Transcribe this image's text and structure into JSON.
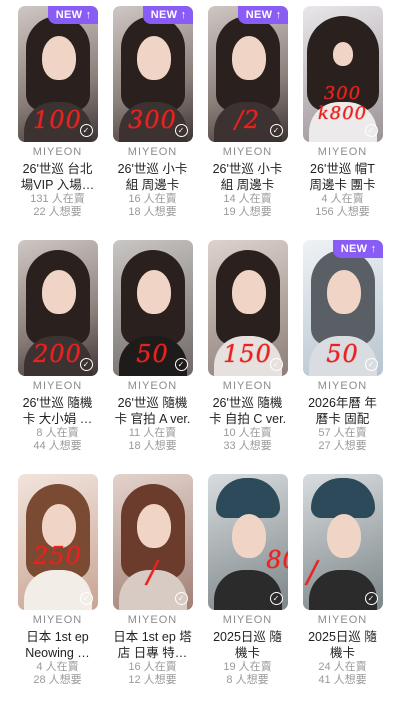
{
  "colors": {
    "accent": "#8a5cf6",
    "price": "#e8231f"
  },
  "cards": [
    {
      "brand": "MIYEON",
      "title1": "26'世巡 台北",
      "title2": "場VIP 入場…",
      "stat1": "131 人在賣",
      "stat2": "22 人想要",
      "new": "NEW ↑",
      "price": "100"
    },
    {
      "brand": "MIYEON",
      "title1": "26'世巡 小卡",
      "title2": "組 周邊卡",
      "stat1": "16 人在賣",
      "stat2": "18 人想要",
      "new": "NEW ↑",
      "price": "300"
    },
    {
      "brand": "MIYEON",
      "title1": "26'世巡 小卡",
      "title2": "組 周邊卡",
      "stat1": "14 人在賣",
      "stat2": "19 人想要",
      "new": "NEW ↑",
      "price": "/2"
    },
    {
      "brand": "MIYEON",
      "title1": "26'世巡 帽T",
      "title2": "周邊卡 團卡",
      "stat1": "4 人在賣",
      "stat2": "156 人想要",
      "new": "",
      "price": "300 k800"
    },
    {
      "brand": "MIYEON",
      "title1": "26'世巡 隨機",
      "title2": "卡 大小娟 …",
      "stat1": "8 人在賣",
      "stat2": "44 人想要",
      "new": "",
      "price": "200"
    },
    {
      "brand": "MIYEON",
      "title1": "26'世巡 隨機",
      "title2": "卡 官拍 A ver.",
      "stat1": "11 人在賣",
      "stat2": "18 人想要",
      "new": "",
      "price": "50"
    },
    {
      "brand": "MIYEON",
      "title1": "26'世巡 隨機",
      "title2": "卡 自拍 C ver.",
      "stat1": "10 人在賣",
      "stat2": "33 人想要",
      "new": "",
      "price": "150"
    },
    {
      "brand": "MIYEON",
      "title1": "2026年曆 年",
      "title2": "曆卡 固配",
      "stat1": "57 人在賣",
      "stat2": "27 人想要",
      "new": "NEW ↑",
      "price": "50"
    },
    {
      "brand": "MIYEON",
      "title1": "日本 1st ep",
      "title2": "Neowing …",
      "stat1": "4 人在賣",
      "stat2": "28 人想要",
      "new": "",
      "price": "250"
    },
    {
      "brand": "MIYEON",
      "title1": "日本 1st ep 塔",
      "title2": "店 日專 特…",
      "stat1": "16 人在賣",
      "stat2": "12 人想要",
      "new": "",
      "price": "/"
    },
    {
      "brand": "MIYEON",
      "title1": "2025日巡 隨",
      "title2": "機卡",
      "stat1": "19 人在賣",
      "stat2": "8 人想要",
      "new": "",
      "price": "80"
    },
    {
      "brand": "MIYEON",
      "title1": "2025日巡 隨",
      "title2": "機卡",
      "stat1": "24 人在賣",
      "stat2": "41 人想要",
      "new": "",
      "price": "/"
    }
  ]
}
